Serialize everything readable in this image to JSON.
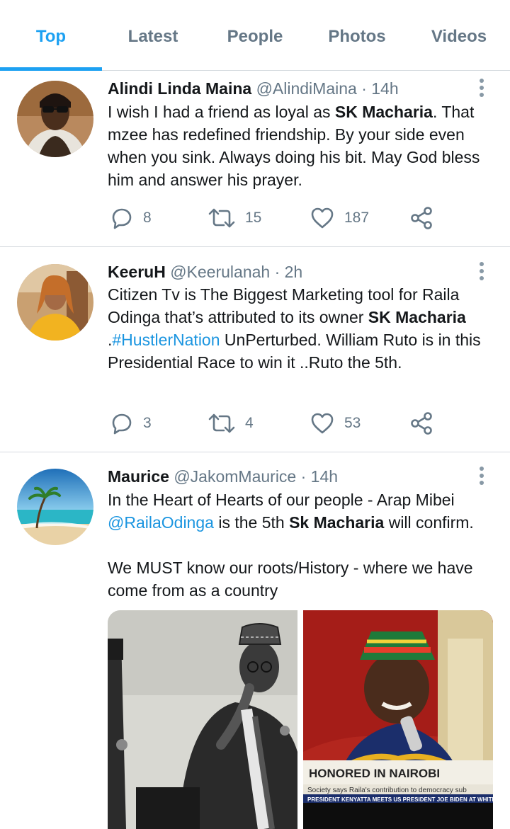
{
  "tabs": [
    "Top",
    "Latest",
    "People",
    "Photos",
    "Videos"
  ],
  "tweets": [
    {
      "name": "Alindi Linda Maina",
      "handle": "@AlindiMaina",
      "time": "· 14h",
      "text_1": "I wish I had a friend  as loyal as ",
      "text_bold_1": "SK Macharia",
      "text_2": ". That mzee has redefined friendship. By your side even when you sink. Always doing his bit. May God bless him and answer his prayer.",
      "replies": "8",
      "retweets": "15",
      "likes": "187"
    },
    {
      "name": "KeeruH",
      "handle": "@Keerulanah",
      "time": "· 2h",
      "text_1": "Citizen Tv is The Biggest Marketing tool for Raila Odinga that’s attributed to its owner ",
      "text_bold_1": "SK Macharia",
      "text_2": " .",
      "hashtag": "#HustlerNation",
      "text_3": " UnPerturbed. William Ruto is in this Presidential Race to win it ..Ruto the 5th.",
      "replies": "3",
      "retweets": "4",
      "likes": "53"
    },
    {
      "name": "Maurice",
      "handle": "@JakomMaurice",
      "time": "· 14h",
      "text_1": "In the Heart of Hearts of our people - Arap Mibei ",
      "mention": "@RailaOdinga",
      "text_2": " is the 5th ",
      "text_bold_1": "Sk Macharia",
      "text_3": " will confirm.",
      "text_4": "We MUST know our roots/History - where we have come from as a country",
      "photo_banner": "HONORED IN NAIROBI",
      "photo_ticker_1": "Society says Raila's contribution to democracy sub",
      "photo_ticker_2": "PRESIDENT KENYATTA MEETS US PRESIDENT JOE BIDEN AT WHITE"
    }
  ],
  "colors": {
    "accent": "#1da1f2",
    "link": "#1b95e0",
    "secondary_text": "#657786",
    "divider": "#d6dbdf"
  }
}
